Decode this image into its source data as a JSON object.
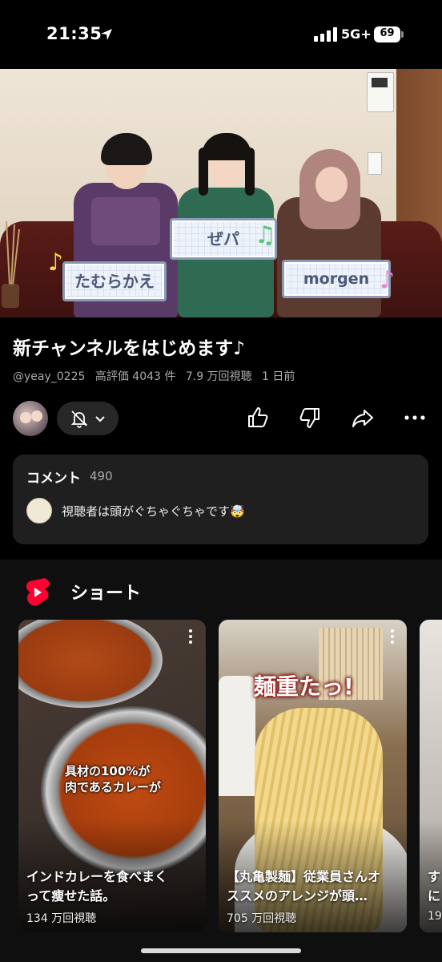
{
  "status_bar": {
    "time": "21:35",
    "network": "5G+",
    "battery": "69"
  },
  "video": {
    "name_labels": [
      "たむらかえ",
      "ぜパ",
      "morgen"
    ]
  },
  "title": "新チャンネルをはじめます♪",
  "meta": {
    "handle": "@yeay_0225",
    "likes": "高評価 4043 件",
    "views": "7.9 万回視聴",
    "age": "1 日前"
  },
  "comments": {
    "label": "コメント",
    "count": "490",
    "top_comment": "視聴者は頭がぐちゃぐちゃです🤯"
  },
  "shorts": {
    "title": "ショート",
    "items": [
      {
        "overlay_text_1": "具材の100%が",
        "overlay_text_2": "肉であるカレーが",
        "title_line1": "インドカレーを食べまく",
        "title_line2": "って痩せた話。",
        "views": "134 万回視聴"
      },
      {
        "overlay_text_1": "麺重たっ!",
        "title_line1": "【丸亀製麺】従業員さんオ",
        "title_line2": "ススメのアレンジが頭…",
        "views": "705 万回視聴"
      },
      {
        "title_line1": "す",
        "title_line2": "に",
        "views": "19"
      }
    ]
  },
  "icons": {
    "location": "location-arrow-icon",
    "signal": "signal-icon",
    "bell": "bell-off-icon",
    "like": "thumb-up-icon",
    "dislike": "thumb-down-icon",
    "share": "share-icon",
    "more": "more-horizontal-icon",
    "shorts": "shorts-logo-icon"
  },
  "colors": {
    "background": "#000000",
    "card": "#1f1f1f",
    "shorts_red": "#ff0033",
    "meta_gray": "#aaaaaa"
  }
}
